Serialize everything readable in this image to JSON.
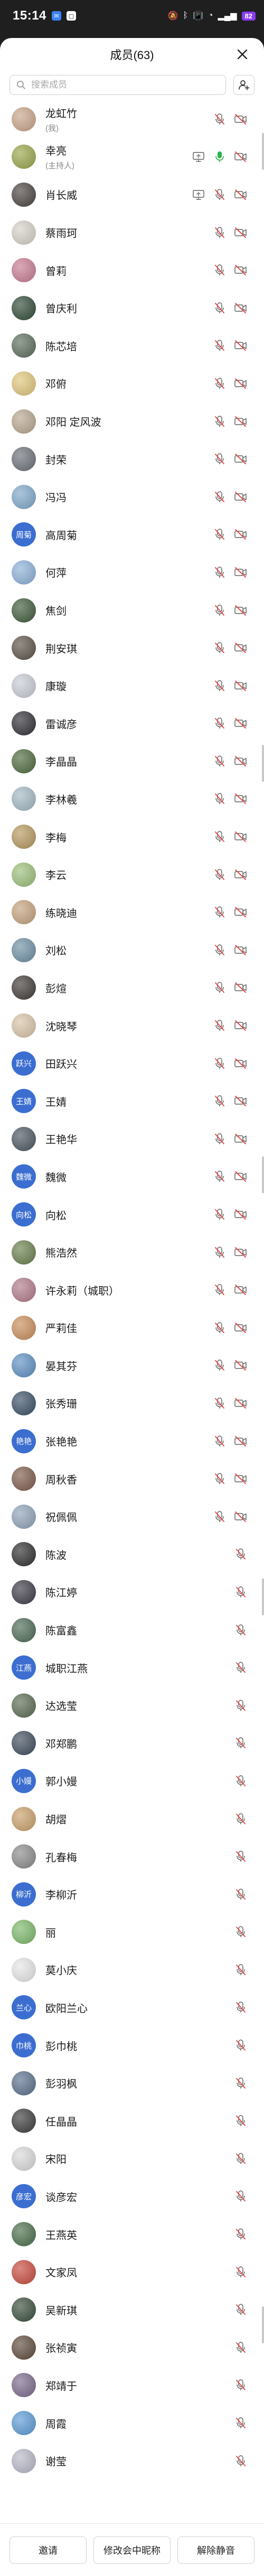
{
  "status_bar": {
    "time": "15:14",
    "app_icons": [
      "message",
      "app"
    ],
    "right_icons": [
      "mute",
      "bluetooth",
      "vibrate",
      "wifi",
      "signal"
    ],
    "battery": "82"
  },
  "header": {
    "title": "成员(63)",
    "close_icon": "close-icon"
  },
  "search": {
    "placeholder": "搜索成员",
    "value": "",
    "icon": "search-icon",
    "invite_icon": "person-add-icon"
  },
  "members": [
    {
      "name": "龙虹竹",
      "sub": "(我)",
      "avatar": {
        "type": "image",
        "color": "#c9a48a",
        "label": ""
      },
      "icons": [
        "mic-muted",
        "video-off"
      ]
    },
    {
      "name": "幸亮",
      "sub": "(主持人)",
      "avatar": {
        "type": "image",
        "color": "#9aa54a",
        "label": ""
      },
      "icons": [
        "screen-share",
        "mic-active",
        "video-off"
      ]
    },
    {
      "name": "肖长威",
      "sub": "",
      "avatar": {
        "type": "image",
        "color": "#4a4340",
        "label": ""
      },
      "icons": [
        "screen-share",
        "mic-muted",
        "video-off"
      ]
    },
    {
      "name": "蔡雨珂",
      "sub": "",
      "avatar": {
        "type": "image",
        "color": "#d6d0c8",
        "label": ""
      },
      "icons": [
        "mic-muted",
        "video-off"
      ]
    },
    {
      "name": "曾莉",
      "sub": "",
      "avatar": {
        "type": "image",
        "color": "#c77b92",
        "label": ""
      },
      "icons": [
        "mic-muted",
        "video-off"
      ]
    },
    {
      "name": "曾庆利",
      "sub": "",
      "avatar": {
        "type": "image",
        "color": "#2f4a36",
        "label": ""
      },
      "icons": [
        "mic-muted",
        "video-off"
      ]
    },
    {
      "name": "陈芯培",
      "sub": "",
      "avatar": {
        "type": "image",
        "color": "#5d6c5d",
        "label": ""
      },
      "icons": [
        "mic-muted",
        "video-off"
      ]
    },
    {
      "name": "邓俯",
      "sub": "",
      "avatar": {
        "type": "image",
        "color": "#e0c67a",
        "label": ""
      },
      "icons": [
        "mic-muted",
        "video-off"
      ]
    },
    {
      "name": "邓阳 定风波",
      "sub": "",
      "avatar": {
        "type": "image",
        "color": "#b8a68f",
        "label": ""
      },
      "icons": [
        "mic-muted",
        "video-off"
      ]
    },
    {
      "name": "封荣",
      "sub": "",
      "avatar": {
        "type": "image",
        "color": "#6c6f78",
        "label": ""
      },
      "icons": [
        "mic-muted",
        "video-off"
      ]
    },
    {
      "name": "冯冯",
      "sub": "",
      "avatar": {
        "type": "image",
        "color": "#7fa8c9",
        "label": ""
      },
      "icons": [
        "mic-muted",
        "video-off"
      ]
    },
    {
      "name": "高周菊",
      "sub": "",
      "avatar": {
        "type": "text",
        "color": "#3b6ed0",
        "label": "周菊"
      },
      "icons": [
        "mic-muted",
        "video-off"
      ]
    },
    {
      "name": "何萍",
      "sub": "",
      "avatar": {
        "type": "image",
        "color": "#8db0d8",
        "label": ""
      },
      "icons": [
        "mic-muted",
        "video-off"
      ]
    },
    {
      "name": "焦剑",
      "sub": "",
      "avatar": {
        "type": "image",
        "color": "#3f5a3a",
        "label": ""
      },
      "icons": [
        "mic-muted",
        "video-off"
      ]
    },
    {
      "name": "荆安琪",
      "sub": "",
      "avatar": {
        "type": "image",
        "color": "#5a5248",
        "label": ""
      },
      "icons": [
        "mic-muted",
        "video-off"
      ]
    },
    {
      "name": "康璇",
      "sub": "",
      "avatar": {
        "type": "image",
        "color": "#c9ccd6",
        "label": ""
      },
      "icons": [
        "mic-muted",
        "video-off"
      ]
    },
    {
      "name": "雷诚彦",
      "sub": "",
      "avatar": {
        "type": "image",
        "color": "#2f2f35",
        "label": ""
      },
      "icons": [
        "mic-muted",
        "video-off"
      ]
    },
    {
      "name": "李晶晶",
      "sub": "",
      "avatar": {
        "type": "image",
        "color": "#4e6a3e",
        "label": ""
      },
      "icons": [
        "mic-muted",
        "video-off"
      ]
    },
    {
      "name": "李林羲",
      "sub": "",
      "avatar": {
        "type": "image",
        "color": "#a3b8c2",
        "label": ""
      },
      "icons": [
        "mic-muted",
        "video-off"
      ]
    },
    {
      "name": "李梅",
      "sub": "",
      "avatar": {
        "type": "image",
        "color": "#b5975e",
        "label": ""
      },
      "icons": [
        "mic-muted",
        "video-off"
      ]
    },
    {
      "name": "李云",
      "sub": "",
      "avatar": {
        "type": "image",
        "color": "#9cbf7a",
        "label": ""
      },
      "icons": [
        "mic-muted",
        "video-off"
      ]
    },
    {
      "name": "练晓迪",
      "sub": "",
      "avatar": {
        "type": "image",
        "color": "#c4a27e",
        "label": ""
      },
      "icons": [
        "mic-muted",
        "video-off"
      ]
    },
    {
      "name": "刘松",
      "sub": "",
      "avatar": {
        "type": "image",
        "color": "#6e8fa3",
        "label": ""
      },
      "icons": [
        "mic-muted",
        "video-off"
      ]
    },
    {
      "name": "彭煊",
      "sub": "",
      "avatar": {
        "type": "image",
        "color": "#3e3a37",
        "label": ""
      },
      "icons": [
        "mic-muted",
        "video-off"
      ]
    },
    {
      "name": "沈晓琴",
      "sub": "",
      "avatar": {
        "type": "image",
        "color": "#d8c3a8",
        "label": ""
      },
      "icons": [
        "mic-muted",
        "video-off"
      ]
    },
    {
      "name": "田跃兴",
      "sub": "",
      "avatar": {
        "type": "text",
        "color": "#3b6ed0",
        "label": "跃兴"
      },
      "icons": [
        "mic-muted",
        "video-off"
      ]
    },
    {
      "name": "王婧",
      "sub": "",
      "avatar": {
        "type": "text",
        "color": "#3b6ed0",
        "label": "王婧"
      },
      "icons": [
        "mic-muted",
        "video-off"
      ]
    },
    {
      "name": "王艳华",
      "sub": "",
      "avatar": {
        "type": "image",
        "color": "#4b5560",
        "label": ""
      },
      "icons": [
        "mic-muted",
        "video-off"
      ]
    },
    {
      "name": "魏微",
      "sub": "",
      "avatar": {
        "type": "text",
        "color": "#3b6ed0",
        "label": "魏微"
      },
      "icons": [
        "mic-muted",
        "video-off"
      ]
    },
    {
      "name": "向松",
      "sub": "",
      "avatar": {
        "type": "text",
        "color": "#3b6ed0",
        "label": "向松"
      },
      "icons": [
        "mic-muted",
        "video-off"
      ]
    },
    {
      "name": "熊浩然",
      "sub": "",
      "avatar": {
        "type": "image",
        "color": "#6a7f4d",
        "label": ""
      },
      "icons": [
        "mic-muted",
        "video-off"
      ]
    },
    {
      "name": "许永莉（城职）",
      "sub": "",
      "avatar": {
        "type": "image",
        "color": "#b07a8a",
        "label": ""
      },
      "icons": [
        "mic-muted",
        "video-off"
      ]
    },
    {
      "name": "严莉佳",
      "sub": "",
      "avatar": {
        "type": "image",
        "color": "#c98d5a",
        "label": ""
      },
      "icons": [
        "mic-muted",
        "video-off"
      ]
    },
    {
      "name": "晏其芬",
      "sub": "",
      "avatar": {
        "type": "image",
        "color": "#5d8fc2",
        "label": ""
      },
      "icons": [
        "mic-muted",
        "video-off"
      ]
    },
    {
      "name": "张秀珊",
      "sub": "",
      "avatar": {
        "type": "image",
        "color": "#3a4f66",
        "label": ""
      },
      "icons": [
        "mic-muted",
        "video-off"
      ]
    },
    {
      "name": "张艳艳",
      "sub": "",
      "avatar": {
        "type": "text",
        "color": "#3b6ed0",
        "label": "艳艳"
      },
      "icons": [
        "mic-muted",
        "video-off"
      ]
    },
    {
      "name": "周秋香",
      "sub": "",
      "avatar": {
        "type": "image",
        "color": "#7d5a4a",
        "label": ""
      },
      "icons": [
        "mic-muted",
        "video-off"
      ]
    },
    {
      "name": "祝佩佩",
      "sub": "",
      "avatar": {
        "type": "image",
        "color": "#8fa2b8",
        "label": ""
      },
      "icons": [
        "mic-muted",
        "video-off"
      ]
    },
    {
      "name": "陈波",
      "sub": "",
      "avatar": {
        "type": "image",
        "color": "#2e2e2e",
        "label": ""
      },
      "icons": [
        "mic-muted"
      ]
    },
    {
      "name": "陈江婷",
      "sub": "",
      "avatar": {
        "type": "image",
        "color": "#3d3a45",
        "label": ""
      },
      "icons": [
        "mic-muted"
      ]
    },
    {
      "name": "陈富鑫",
      "sub": "",
      "avatar": {
        "type": "image",
        "color": "#4d6a56",
        "label": ""
      },
      "icons": [
        "mic-muted"
      ]
    },
    {
      "name": "城职江燕",
      "sub": "",
      "avatar": {
        "type": "text",
        "color": "#3b6ed0",
        "label": "江燕"
      },
      "icons": [
        "mic-muted"
      ]
    },
    {
      "name": "达选莹",
      "sub": "",
      "avatar": {
        "type": "image",
        "color": "#5b6b52",
        "label": ""
      },
      "icons": [
        "mic-muted"
      ]
    },
    {
      "name": "邓郑鹏",
      "sub": "",
      "avatar": {
        "type": "image",
        "color": "#3f4b5c",
        "label": ""
      },
      "icons": [
        "mic-muted"
      ]
    },
    {
      "name": "郭小嫚",
      "sub": "",
      "avatar": {
        "type": "text",
        "color": "#3b6ed0",
        "label": "小嫚"
      },
      "icons": [
        "mic-muted"
      ]
    },
    {
      "name": "胡熠",
      "sub": "",
      "avatar": {
        "type": "image",
        "color": "#c9a06a",
        "label": ""
      },
      "icons": [
        "mic-muted"
      ]
    },
    {
      "name": "孔春梅",
      "sub": "",
      "avatar": {
        "type": "image",
        "color": "#8a8a8a",
        "label": ""
      },
      "icons": [
        "mic-muted"
      ]
    },
    {
      "name": "李柳沂",
      "sub": "",
      "avatar": {
        "type": "text",
        "color": "#3b6ed0",
        "label": "柳沂"
      },
      "icons": [
        "mic-muted"
      ]
    },
    {
      "name": "丽",
      "sub": "",
      "avatar": {
        "type": "image",
        "color": "#7cb86a",
        "label": ""
      },
      "icons": [
        "mic-muted"
      ]
    },
    {
      "name": "莫小庆",
      "sub": "",
      "avatar": {
        "type": "image",
        "color": "#e6e6e6",
        "label": ""
      },
      "icons": [
        "mic-muted"
      ]
    },
    {
      "name": "欧阳兰心",
      "sub": "",
      "avatar": {
        "type": "text",
        "color": "#3b6ed0",
        "label": "兰心"
      },
      "icons": [
        "mic-muted"
      ]
    },
    {
      "name": "彭巾桃",
      "sub": "",
      "avatar": {
        "type": "text",
        "color": "#3b6ed0",
        "label": "巾桃"
      },
      "icons": [
        "mic-muted"
      ]
    },
    {
      "name": "彭羽枫",
      "sub": "",
      "avatar": {
        "type": "image",
        "color": "#5a6f8c",
        "label": ""
      },
      "icons": [
        "mic-muted"
      ]
    },
    {
      "name": "任晶晶",
      "sub": "",
      "avatar": {
        "type": "image",
        "color": "#3c3c3c",
        "label": ""
      },
      "icons": [
        "mic-muted"
      ]
    },
    {
      "name": "宋阳",
      "sub": "",
      "avatar": {
        "type": "image",
        "color": "#d9d9d9",
        "label": ""
      },
      "icons": [
        "mic-muted"
      ]
    },
    {
      "name": "谈彦宏",
      "sub": "",
      "avatar": {
        "type": "text",
        "color": "#3b6ed0",
        "label": "彦宏"
      },
      "icons": [
        "mic-muted"
      ]
    },
    {
      "name": "王燕英",
      "sub": "",
      "avatar": {
        "type": "image",
        "color": "#4a6e4a",
        "label": ""
      },
      "icons": [
        "mic-muted"
      ]
    },
    {
      "name": "文家凤",
      "sub": "",
      "avatar": {
        "type": "image",
        "color": "#c74a3e",
        "label": ""
      },
      "icons": [
        "mic-muted"
      ]
    },
    {
      "name": "吴新琪",
      "sub": "",
      "avatar": {
        "type": "image",
        "color": "#384d3a",
        "label": ""
      },
      "icons": [
        "mic-muted"
      ]
    },
    {
      "name": "张祯寅",
      "sub": "",
      "avatar": {
        "type": "image",
        "color": "#5d4a3c",
        "label": ""
      },
      "icons": [
        "mic-muted"
      ]
    },
    {
      "name": "郑靖于",
      "sub": "",
      "avatar": {
        "type": "image",
        "color": "#7a6a8c",
        "label": ""
      },
      "icons": [
        "mic-muted"
      ]
    },
    {
      "name": "周霞",
      "sub": "",
      "avatar": {
        "type": "image",
        "color": "#5b9ad6",
        "label": ""
      },
      "icons": [
        "mic-muted"
      ]
    },
    {
      "name": "谢莹",
      "sub": "",
      "avatar": {
        "type": "image",
        "color": "#b8b8c8",
        "label": ""
      },
      "icons": [
        "mic-muted"
      ]
    }
  ],
  "bottom_bar": {
    "invite_label": "邀请",
    "rename_label": "修改会中昵称",
    "unmute_all_label": "解除静音"
  },
  "colors": {
    "mic_active": "#2bb24c",
    "video_off": "#e24a4a",
    "icon_gray": "#777777",
    "text_avatar": "#3b6ed0"
  }
}
